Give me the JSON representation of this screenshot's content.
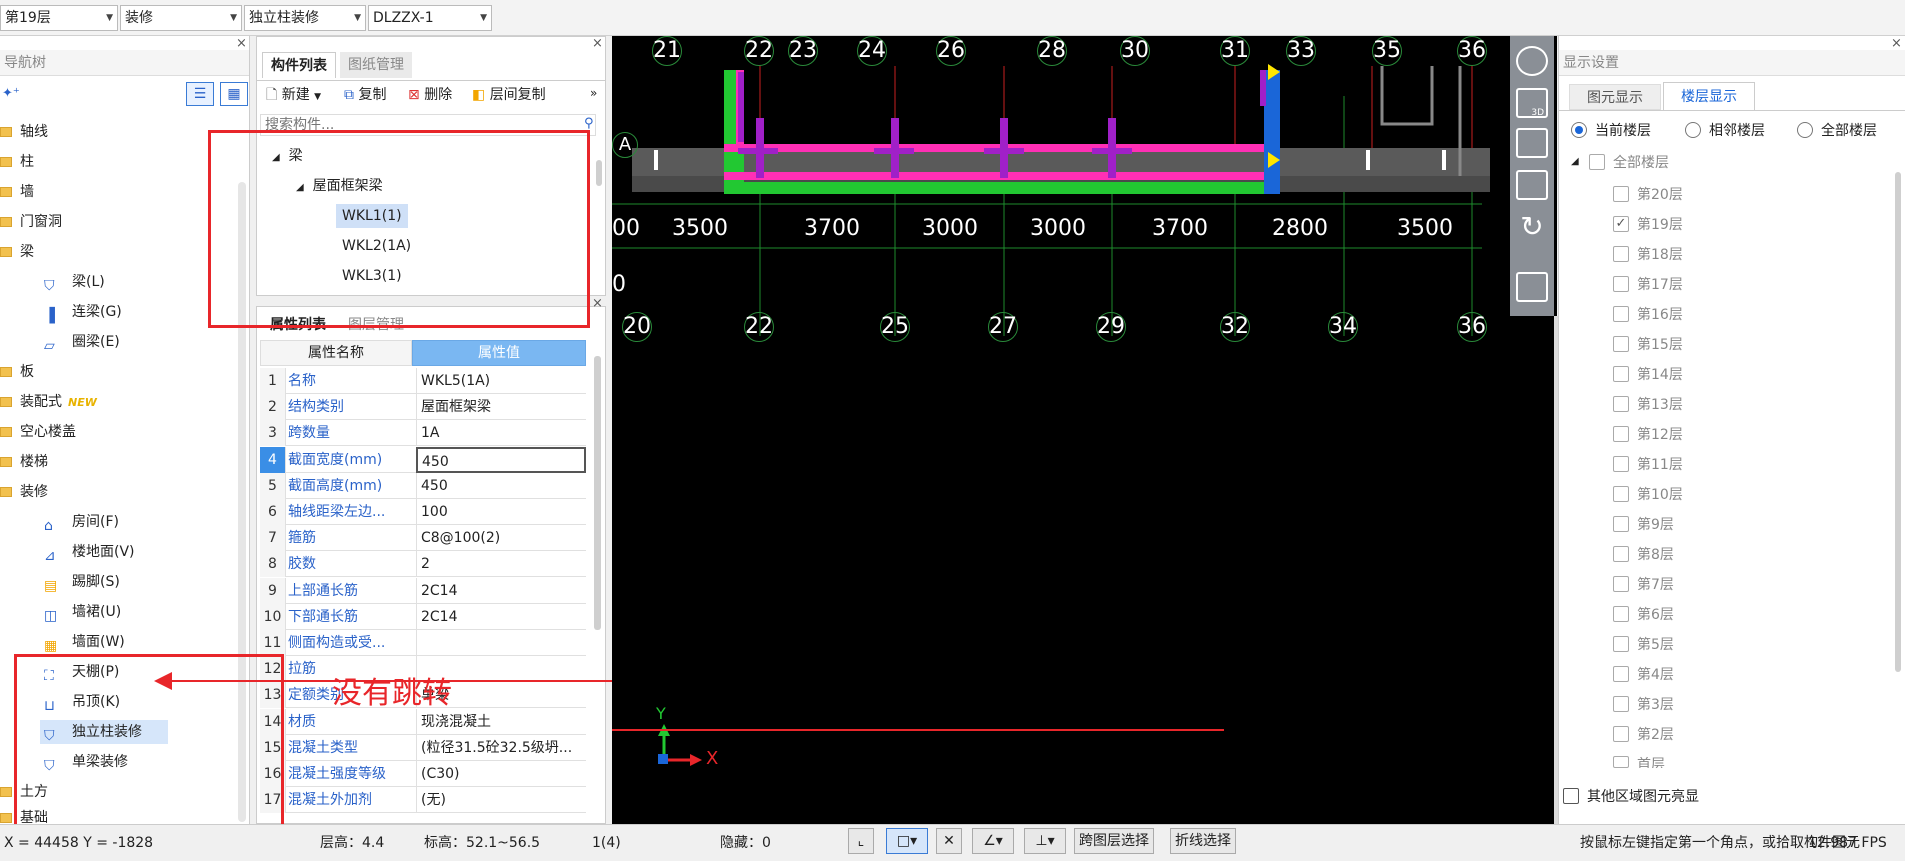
{
  "topbar": {
    "floor": "第19层",
    "category": "装修",
    "subtype": "独立柱装修",
    "component": "DLZZX-1"
  },
  "nav": {
    "title": "导航树",
    "items": [
      {
        "label": "轴线"
      },
      {
        "label": "柱"
      },
      {
        "label": "墙"
      },
      {
        "label": "门窗洞"
      },
      {
        "label": "梁"
      },
      {
        "label": "梁(L)"
      },
      {
        "label": "连梁(G)"
      },
      {
        "label": "圈梁(E)"
      },
      {
        "label": "板"
      },
      {
        "label": "装配式",
        "badge": "NEW"
      },
      {
        "label": "空心楼盖"
      },
      {
        "label": "楼梯"
      },
      {
        "label": "装修"
      },
      {
        "label": "房间(F)"
      },
      {
        "label": "楼地面(V)"
      },
      {
        "label": "踢脚(S)"
      },
      {
        "label": "墙裙(U)"
      },
      {
        "label": "墙面(W)"
      },
      {
        "label": "天棚(P)"
      },
      {
        "label": "吊顶(K)"
      },
      {
        "label": "独立柱装修"
      },
      {
        "label": "单梁装修"
      },
      {
        "label": "土方"
      },
      {
        "label": "基础"
      }
    ]
  },
  "complist": {
    "tabs": [
      "构件列表",
      "图纸管理"
    ],
    "tools": [
      "新建",
      "复制",
      "删除",
      "层间复制"
    ],
    "search_placeholder": "搜索构件...",
    "tree": {
      "root": "梁",
      "group": "屋面框架梁",
      "items": [
        "WKL1(1)",
        "WKL2(1A)",
        "WKL3(1)"
      ]
    }
  },
  "propgrid": {
    "tabs": [
      "属性列表",
      "图层管理"
    ],
    "headers": [
      "属性名称",
      "属性值"
    ],
    "rows": [
      {
        "n": "1",
        "k": "名称",
        "v": "WKL5(1A)"
      },
      {
        "n": "2",
        "k": "结构类别",
        "v": "屋面框架梁"
      },
      {
        "n": "3",
        "k": "跨数量",
        "v": "1A"
      },
      {
        "n": "4",
        "k": "截面宽度(mm)",
        "v": "450"
      },
      {
        "n": "5",
        "k": "截面高度(mm)",
        "v": "450"
      },
      {
        "n": "6",
        "k": "轴线距梁左边...",
        "v": "100"
      },
      {
        "n": "7",
        "k": "箍筋",
        "v": "C8@100(2)"
      },
      {
        "n": "8",
        "k": "胶数",
        "v": "2"
      },
      {
        "n": "9",
        "k": "上部通长筋",
        "v": "2C14"
      },
      {
        "n": "10",
        "k": "下部通长筋",
        "v": "2C14"
      },
      {
        "n": "11",
        "k": "侧面构造或受...",
        "v": ""
      },
      {
        "n": "12",
        "k": "拉筋",
        "v": ""
      },
      {
        "n": "13",
        "k": "定额类别",
        "v": "单梁"
      },
      {
        "n": "14",
        "k": "材质",
        "v": "现浇混凝土"
      },
      {
        "n": "15",
        "k": "混凝土类型",
        "v": "(粒径31.5砼32.5级坍..."
      },
      {
        "n": "16",
        "k": "混凝土强度等级",
        "v": "(C30)"
      },
      {
        "n": "17",
        "k": "混凝土外加剂",
        "v": "(无)"
      }
    ]
  },
  "canvas": {
    "top_axes": [
      "21",
      "22",
      "23",
      "24",
      "26",
      "28",
      "30",
      "31",
      "33",
      "35",
      "36"
    ],
    "row_axis": "A",
    "dims": [
      "00",
      "3500",
      "3700",
      "3000",
      "3000",
      "3700",
      "2800",
      "3500"
    ],
    "left_zero": "0",
    "bottom_axes": [
      "20",
      "22",
      "25",
      "27",
      "29",
      "32",
      "34",
      "36"
    ],
    "axis_x": "X",
    "axis_y": "Y",
    "annotation": "没有跳转"
  },
  "display": {
    "title": "显示设置",
    "tabs": [
      "图元显示",
      "楼层显示"
    ],
    "radios": [
      "当前楼层",
      "相邻楼层",
      "全部楼层"
    ],
    "all_floors": "全部楼层",
    "floors": [
      "第20层",
      "第19层",
      "第18层",
      "第17层",
      "第16层",
      "第15层",
      "第14层",
      "第13层",
      "第12层",
      "第11层",
      "第10层",
      "第9层",
      "第8层",
      "第7层",
      "第6层",
      "第5层",
      "第4层",
      "第3层",
      "第2层",
      "首层"
    ],
    "other_area": "其他区域图元亮显"
  },
  "status": {
    "coords": "X = 44458 Y = -1828",
    "floor_height": "层高：4.4",
    "elevation": "标高：52.1~56.5",
    "count": "1(4)",
    "hidden": "隐藏：0",
    "btn_cross_floor": "跨图层选择",
    "btn_polyline": "折线选择",
    "hint": "按鼠标左键指定第一个角点，或拾取构件图元",
    "fps": "12.987 FPS"
  },
  "colors": {
    "annotation_red": "#e8262a",
    "beam_magenta": "#ff2fb5",
    "slab_green": "#22c832",
    "selection_blue": "#1a66d8"
  }
}
